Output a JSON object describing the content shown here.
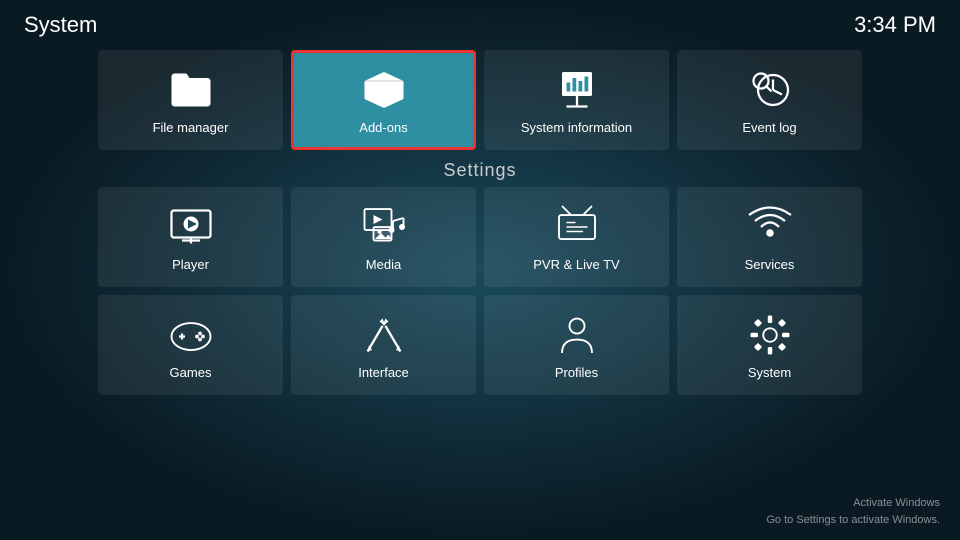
{
  "header": {
    "title": "System",
    "time": "3:34 PM"
  },
  "top_row": [
    {
      "id": "file-manager",
      "label": "File manager"
    },
    {
      "id": "add-ons",
      "label": "Add-ons",
      "selected": true
    },
    {
      "id": "system-information",
      "label": "System information"
    },
    {
      "id": "event-log",
      "label": "Event log"
    }
  ],
  "settings_label": "Settings",
  "settings_row1": [
    {
      "id": "player",
      "label": "Player"
    },
    {
      "id": "media",
      "label": "Media"
    },
    {
      "id": "pvr-live-tv",
      "label": "PVR & Live TV"
    },
    {
      "id": "services",
      "label": "Services"
    }
  ],
  "settings_row2": [
    {
      "id": "games",
      "label": "Games"
    },
    {
      "id": "interface",
      "label": "Interface"
    },
    {
      "id": "profiles",
      "label": "Profiles"
    },
    {
      "id": "system",
      "label": "System"
    }
  ],
  "watermark": {
    "line1": "Activate Windows",
    "line2": "Go to Settings to activate Windows."
  }
}
